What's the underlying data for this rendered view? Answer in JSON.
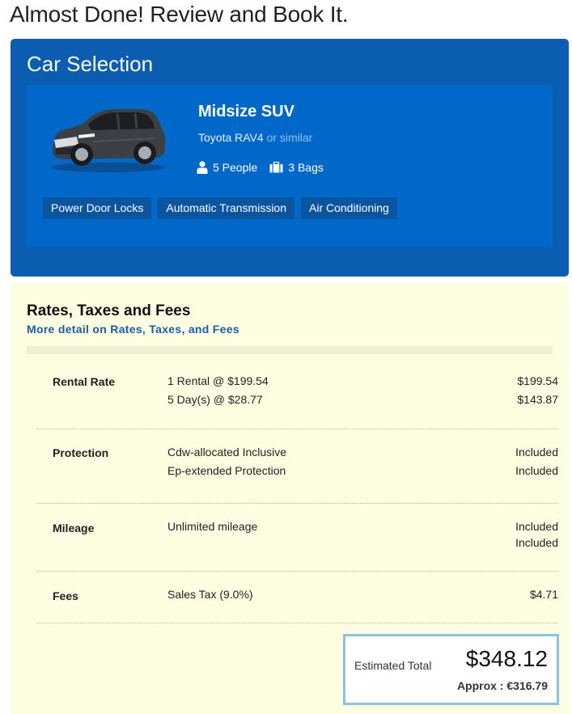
{
  "page": {
    "title": "Almost Done! Review and Book It."
  },
  "car_selection": {
    "heading": "Car Selection",
    "car_class": "Midsize SUV",
    "model": "Toyota RAV4",
    "similar_text": "or similar",
    "people": "5 People",
    "bags": "3 Bags",
    "features": [
      "Power Door Locks",
      "Automatic Transmission",
      "Air Conditioning"
    ],
    "image_icon": "car-photo-icon"
  },
  "rates": {
    "heading": "Rates, Taxes and Fees",
    "detail_link": "More detail on Rates, Taxes, and Fees",
    "sections": [
      {
        "label": "Rental Rate",
        "lines": [
          "1 Rental @ $199.54",
          "5 Day(s) @ $28.77"
        ],
        "amounts": [
          "$199.54",
          "$143.87"
        ]
      },
      {
        "label": "Protection",
        "lines": [
          "Cdw-allocated Inclusive",
          "Ep-extended Protection"
        ],
        "amounts": [
          "Included",
          "Included"
        ]
      },
      {
        "label": "Mileage",
        "lines": [
          "Unlimited mileage"
        ],
        "amounts": [
          "Included",
          "Included"
        ]
      },
      {
        "label": "Fees",
        "lines": [
          "Sales Tax (9.0%)"
        ],
        "amounts": [
          "$4.71"
        ]
      }
    ]
  },
  "total": {
    "label": "Estimated Total",
    "amount": "$348.12",
    "approx": "Approx : €316.79"
  },
  "colors": {
    "panel_blue": "#0a5db0",
    "card_blue": "#0068c9",
    "rates_bg": "#fdfde1",
    "link_blue": "#1a5fa6",
    "total_border": "#8dc1ea"
  }
}
